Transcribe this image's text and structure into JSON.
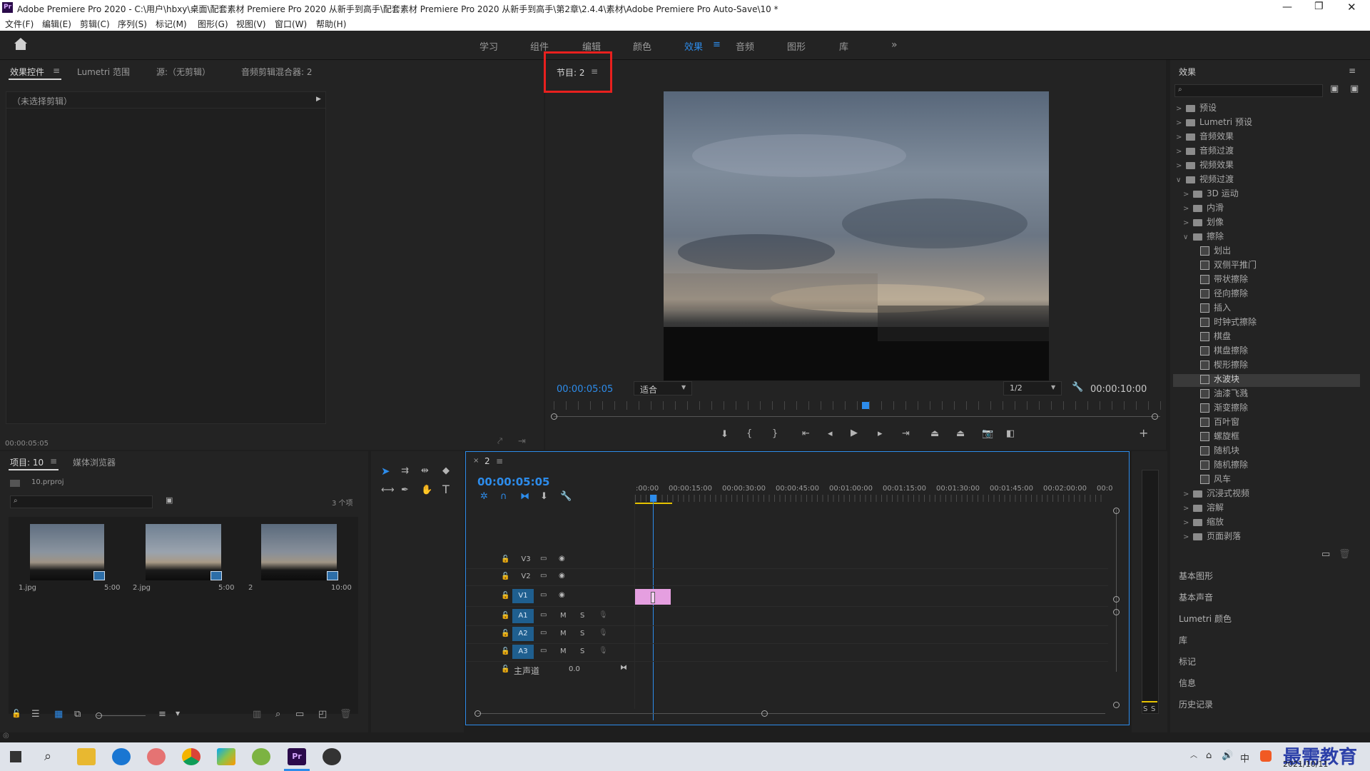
{
  "window": {
    "title": "Adobe Premiere Pro 2020 - C:\\用户\\hbxy\\桌面\\配套素材 Premiere Pro 2020 从新手到高手\\配套素材 Premiere Pro 2020 从新手到高手\\第2章\\2.4.4\\素材\\Adobe Premiere Pro Auto-Save\\10 *",
    "app_icon": "Pr"
  },
  "menu": [
    "文件(F)",
    "编辑(E)",
    "剪辑(C)",
    "序列(S)",
    "标记(M)",
    "图形(G)",
    "视图(V)",
    "窗口(W)",
    "帮助(H)"
  ],
  "workspaces": [
    "学习",
    "组件",
    "编辑",
    "颜色",
    "效果",
    "音频",
    "图形",
    "库"
  ],
  "active_workspace": "效果",
  "top_left_panel": {
    "tabs": [
      "效果控件",
      "Lumetri 范围",
      "源:（无剪辑）",
      "音频剪辑混合器: 2"
    ],
    "no_clip": "（未选择剪辑）",
    "timecode": "00:00:05:05"
  },
  "program_monitor": {
    "tab": "节目: 2",
    "timecode": "00:00:05:05",
    "fit": "适合",
    "resolution": "1/2",
    "duration": "00:00:10:00"
  },
  "project_panel": {
    "tabs": [
      "项目: 10",
      "媒体浏览器"
    ],
    "file": "10.prproj",
    "count": "3 个项",
    "items": [
      {
        "name": "1.jpg",
        "duration": "5:00"
      },
      {
        "name": "2.jpg",
        "duration": "5:00"
      },
      {
        "name": "2",
        "duration": "10:00"
      }
    ]
  },
  "timeline": {
    "sequence": "2",
    "timecode": "00:00:05:05",
    "ruler": [
      ":00:00",
      "00:00:15:00",
      "00:00:30:00",
      "00:00:45:00",
      "00:01:00:00",
      "00:01:15:00",
      "00:01:30:00",
      "00:01:45:00",
      "00:02:00:00",
      "00:0"
    ],
    "video_tracks": [
      "V3",
      "V2",
      "V1"
    ],
    "audio_tracks": [
      "A1",
      "A2",
      "A3"
    ],
    "master": "主声道",
    "master_value": "0.0",
    "m_label": "M",
    "s_label": "S"
  },
  "effects_panel": {
    "title": "效果",
    "tree": [
      {
        "label": "预设",
        "level": 0,
        "type": "folder",
        "open": false
      },
      {
        "label": "Lumetri 预设",
        "level": 0,
        "type": "folder",
        "open": false
      },
      {
        "label": "音频效果",
        "level": 0,
        "type": "folder",
        "open": false
      },
      {
        "label": "音频过渡",
        "level": 0,
        "type": "folder",
        "open": false
      },
      {
        "label": "视频效果",
        "level": 0,
        "type": "folder",
        "open": false
      },
      {
        "label": "视频过渡",
        "level": 0,
        "type": "folder",
        "open": true
      },
      {
        "label": "3D 运动",
        "level": 1,
        "type": "folder",
        "open": false
      },
      {
        "label": "内滑",
        "level": 1,
        "type": "folder",
        "open": false
      },
      {
        "label": "划像",
        "level": 1,
        "type": "folder",
        "open": false
      },
      {
        "label": "擦除",
        "level": 1,
        "type": "folder",
        "open": true
      },
      {
        "label": "划出",
        "level": 2,
        "type": "fx"
      },
      {
        "label": "双侧平推门",
        "level": 2,
        "type": "fx"
      },
      {
        "label": "带状擦除",
        "level": 2,
        "type": "fx"
      },
      {
        "label": "径向擦除",
        "level": 2,
        "type": "fx"
      },
      {
        "label": "插入",
        "level": 2,
        "type": "fx"
      },
      {
        "label": "时钟式擦除",
        "level": 2,
        "type": "fx"
      },
      {
        "label": "棋盘",
        "level": 2,
        "type": "fx"
      },
      {
        "label": "棋盘擦除",
        "level": 2,
        "type": "fx"
      },
      {
        "label": "楔形擦除",
        "level": 2,
        "type": "fx"
      },
      {
        "label": "水波块",
        "level": 2,
        "type": "fx",
        "selected": true
      },
      {
        "label": "油漆飞溅",
        "level": 2,
        "type": "fx"
      },
      {
        "label": "渐变擦除",
        "level": 2,
        "type": "fx"
      },
      {
        "label": "百叶窗",
        "level": 2,
        "type": "fx"
      },
      {
        "label": "螺旋框",
        "level": 2,
        "type": "fx"
      },
      {
        "label": "随机块",
        "level": 2,
        "type": "fx"
      },
      {
        "label": "随机擦除",
        "level": 2,
        "type": "fx"
      },
      {
        "label": "风车",
        "level": 2,
        "type": "fx"
      },
      {
        "label": "沉浸式视频",
        "level": 1,
        "type": "folder",
        "open": false
      },
      {
        "label": "溶解",
        "level": 1,
        "type": "folder",
        "open": false
      },
      {
        "label": "缩放",
        "level": 1,
        "type": "folder",
        "open": false
      },
      {
        "label": "页面剥落",
        "level": 1,
        "type": "folder",
        "open": false
      }
    ],
    "side_panels": [
      "基本图形",
      "基本声音",
      "Lumetri 颜色",
      "库",
      "标记",
      "信息",
      "历史记录"
    ]
  },
  "audio_meter": {
    "labels": [
      "S",
      "S"
    ]
  },
  "taskbar": {
    "date": "2021/10/11",
    "watermark": "最需教育",
    "ime": "中"
  },
  "colors": {
    "accent": "#2d8ceb",
    "highlight_box": "#e8201e",
    "clip": "#e59fe0",
    "track_blue": "#1f5f8f"
  }
}
